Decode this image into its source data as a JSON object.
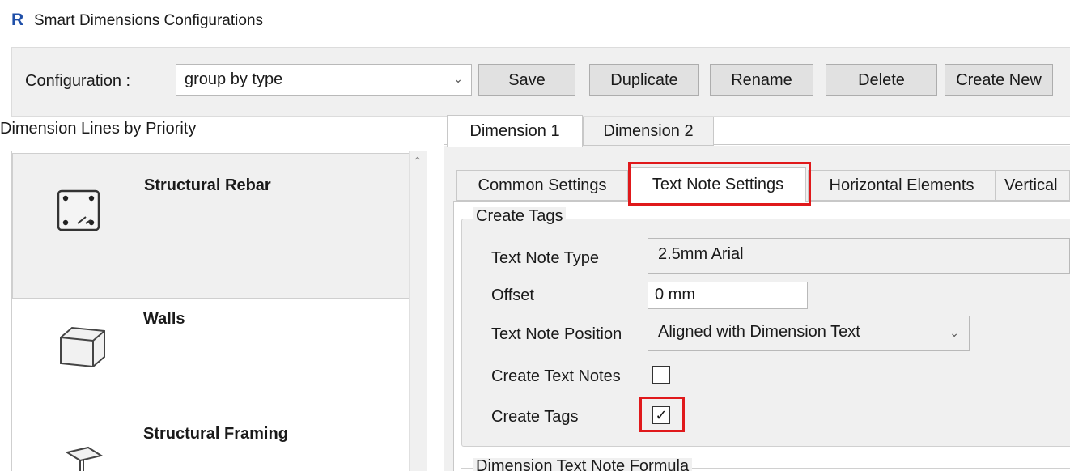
{
  "window": {
    "app_icon": "R",
    "title": "Smart Dimensions Configurations"
  },
  "toolbar": {
    "configuration_label": "Configuration  :",
    "configuration_value": "group by type",
    "buttons": {
      "save": "Save",
      "duplicate": "Duplicate",
      "rename": "Rename",
      "delete": "Delete",
      "create_new": "Create New"
    }
  },
  "left_panel": {
    "heading": "Dimension Lines by Priority",
    "items": [
      {
        "label": "Structural Rebar",
        "icon": "structural-rebar-icon",
        "selected": true
      },
      {
        "label": "Walls",
        "icon": "wall-icon",
        "selected": false
      },
      {
        "label": "Structural Framing",
        "icon": "structural-framing-icon",
        "selected": false
      }
    ]
  },
  "dimension_tabs": [
    {
      "label": "Dimension 1",
      "active": true
    },
    {
      "label": "Dimension 2",
      "active": false
    }
  ],
  "settings_tabs": [
    {
      "label": "Common Settings",
      "active": false
    },
    {
      "label": "Text Note Settings",
      "active": true
    },
    {
      "label": "Horizontal Elements",
      "active": false
    },
    {
      "label": "Vertical",
      "active": false
    }
  ],
  "create_tags_group": {
    "title": "Create Tags",
    "text_note_type_label": "Text Note Type",
    "text_note_type_value": "2.5mm Arial",
    "offset_label": "Offset",
    "offset_value": "0 mm",
    "text_note_position_label": "Text Note Position",
    "text_note_position_value": "Aligned with Dimension Text",
    "create_text_notes_label": "Create Text Notes",
    "create_text_notes_checked": false,
    "create_tags_label": "Create Tags",
    "create_tags_checked": true,
    "check_mark": "✓"
  },
  "formula_group": {
    "title": "Dimension Text Note Formula"
  },
  "colors": {
    "highlight": "#e0191b",
    "app_icon": "#1f4fa8",
    "panel_bg": "#f0f0f0"
  }
}
